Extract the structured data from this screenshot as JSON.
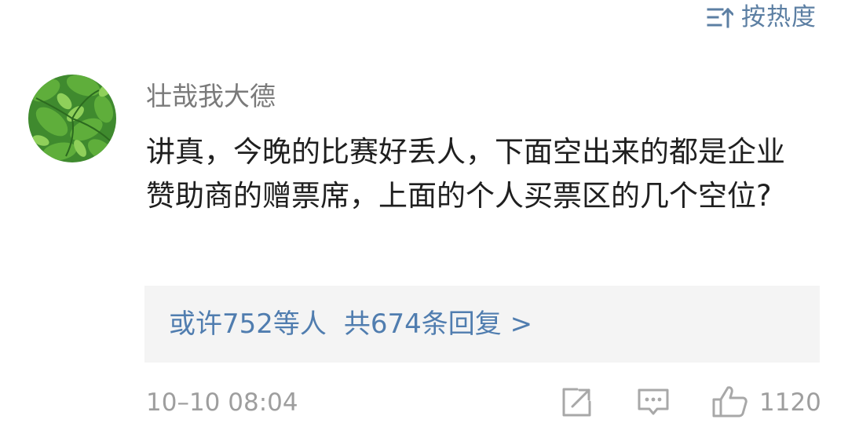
{
  "header": {
    "sort_label": "按热度",
    "sort_icon": "sort-lines-icon"
  },
  "comment": {
    "username": "壮哉我大德",
    "avatar_icon": "parsley-leaf-avatar",
    "text": "讲真，今晚的比赛好丢人，下面空出来的都是企业赞助商的赠票席，上面的个人买票区的几个空位?",
    "replies": {
      "from": "或许752等人",
      "total": "共674条回复 >"
    },
    "timestamp": "10–10 08:04",
    "actions": {
      "forward_icon": "share-arrow-icon",
      "comment_icon": "comment-bubble-icon",
      "like_icon": "thumbs-up-icon",
      "like_count": "1120"
    }
  },
  "colors": {
    "link": "#507daf",
    "meta": "#9e9e9e",
    "reply_bg": "#f4f4f4"
  }
}
